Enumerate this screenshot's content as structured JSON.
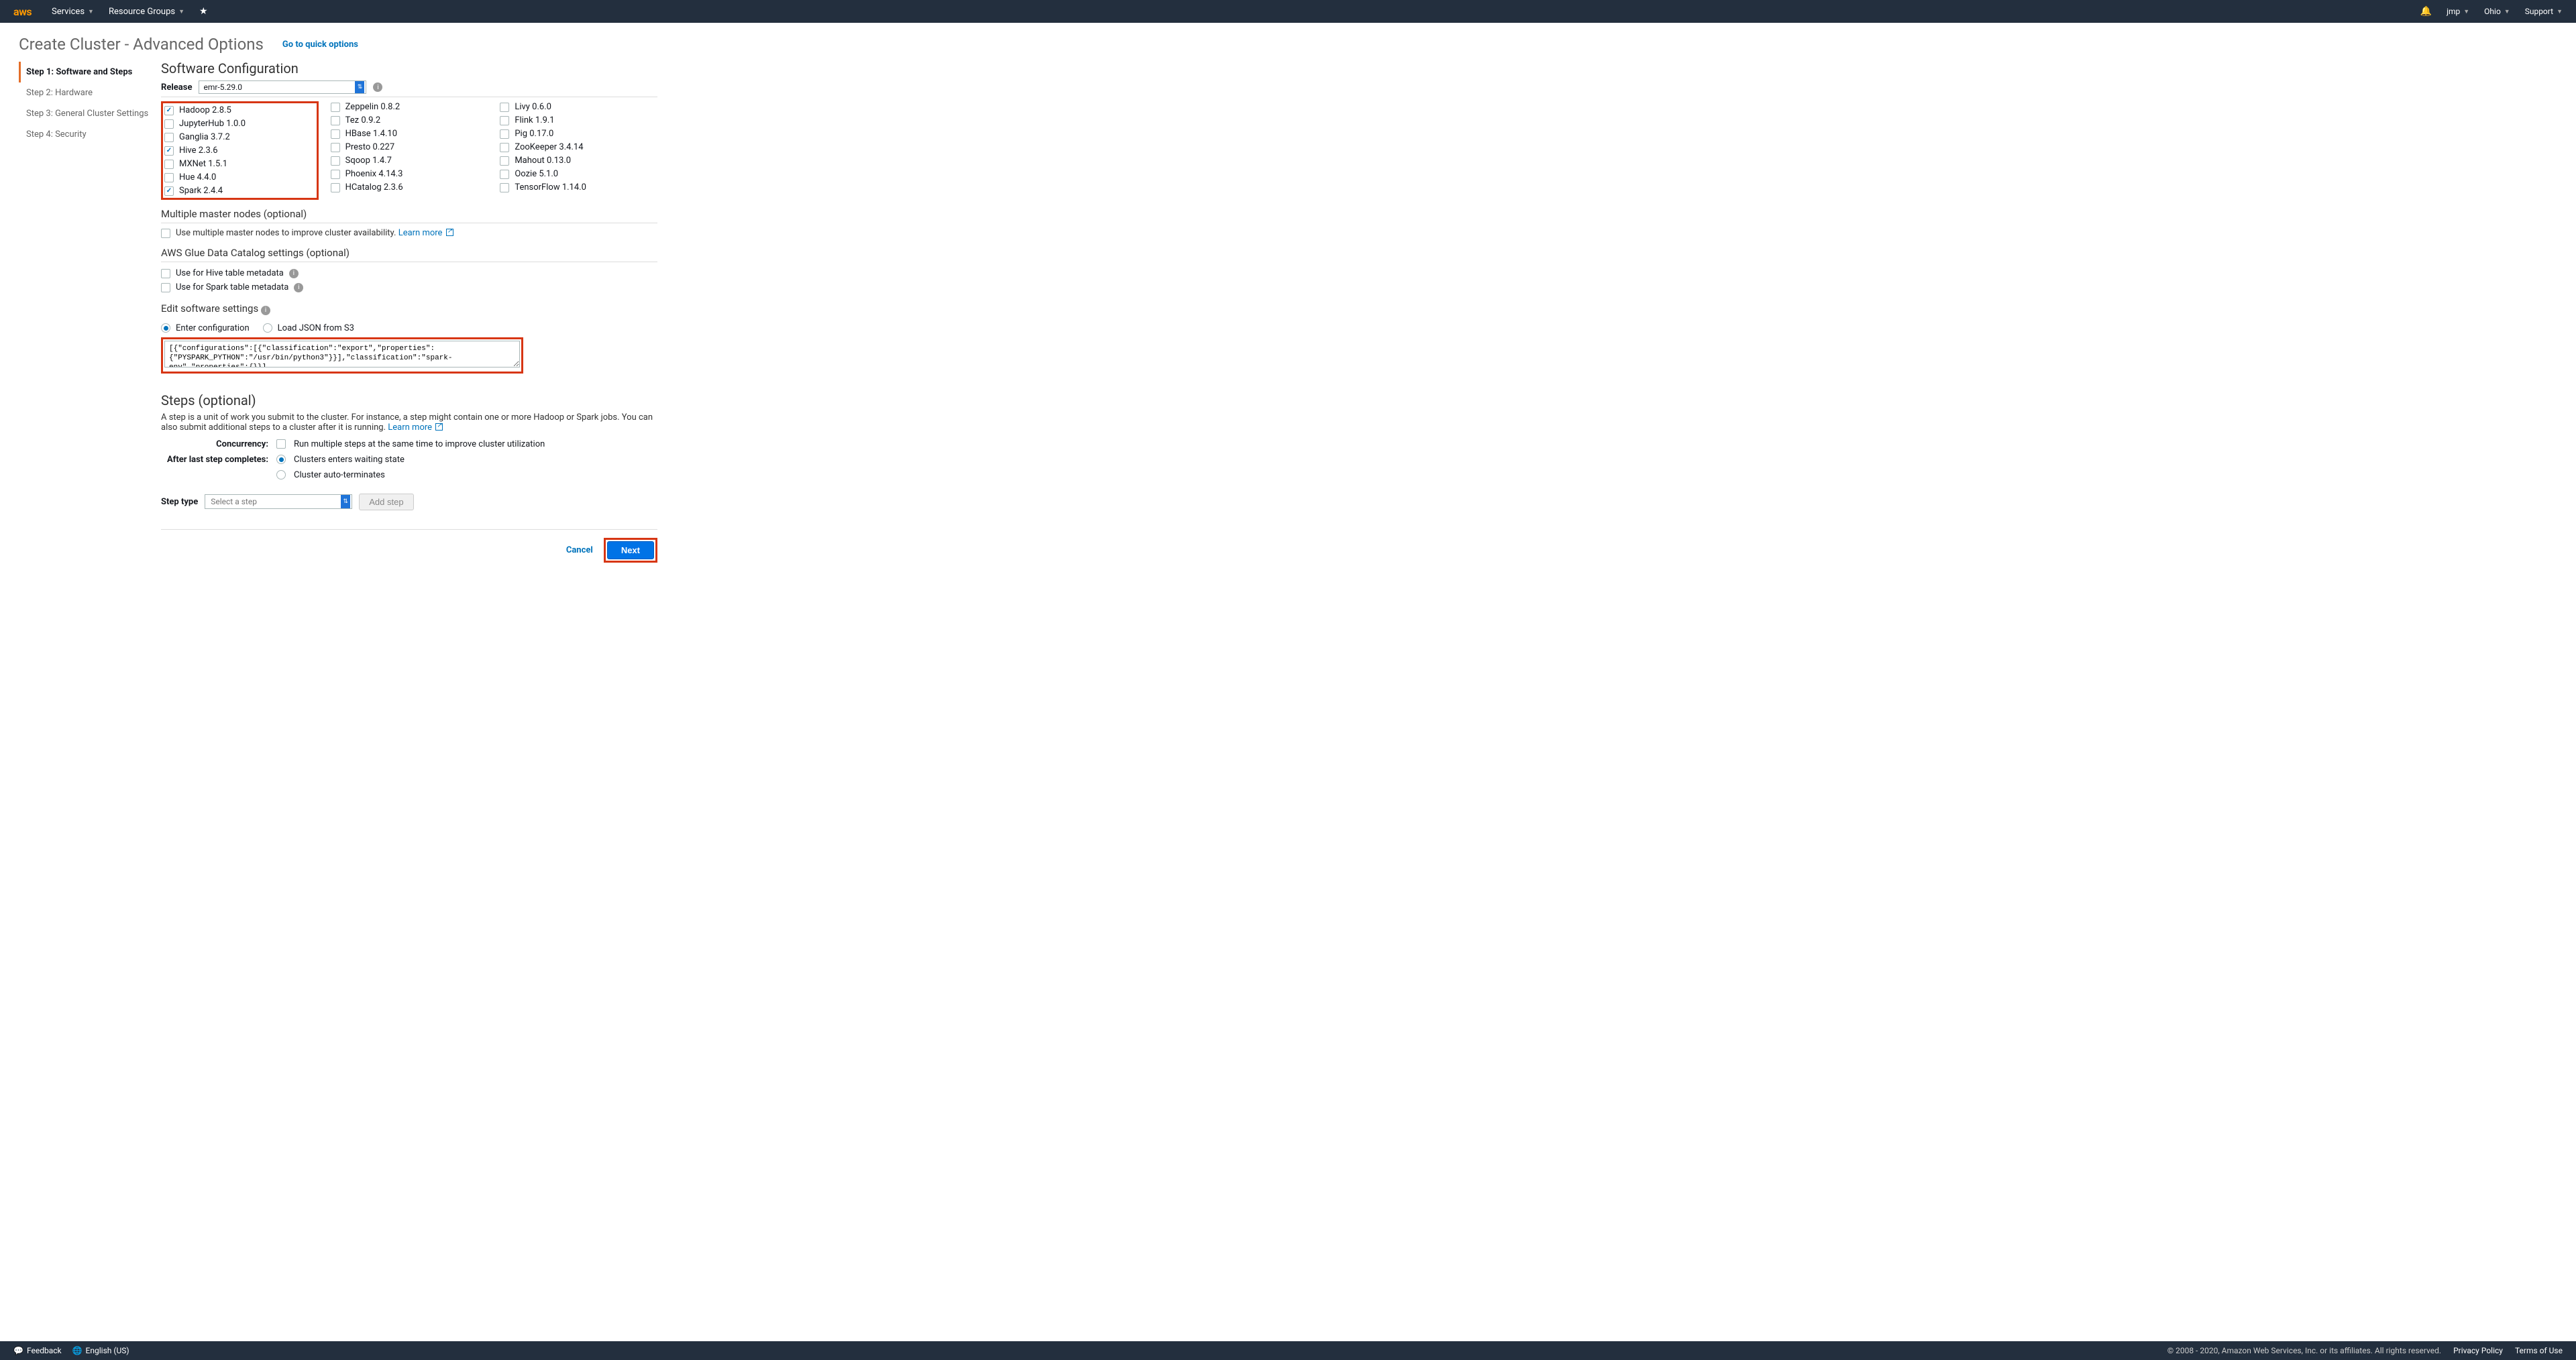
{
  "topbar": {
    "logo": "aws",
    "services": "Services",
    "resource_groups": "Resource Groups",
    "username": "jmp",
    "region": "Ohio",
    "support": "Support"
  },
  "page": {
    "title": "Create Cluster - Advanced Options",
    "quick_link": "Go to quick options"
  },
  "steps": [
    {
      "label": "Step 1: Software and Steps",
      "active": true
    },
    {
      "label": "Step 2: Hardware",
      "active": false
    },
    {
      "label": "Step 3: General Cluster Settings",
      "active": false
    },
    {
      "label": "Step 4: Security",
      "active": false
    }
  ],
  "software": {
    "section_title": "Software Configuration",
    "release_label": "Release",
    "release_value": "emr-5.29.0",
    "columns": [
      [
        {
          "label": "Hadoop 2.8.5",
          "checked": true
        },
        {
          "label": "JupyterHub 1.0.0",
          "checked": false
        },
        {
          "label": "Ganglia 3.7.2",
          "checked": false
        },
        {
          "label": "Hive 2.3.6",
          "checked": true
        },
        {
          "label": "MXNet 1.5.1",
          "checked": false
        },
        {
          "label": "Hue 4.4.0",
          "checked": false
        },
        {
          "label": "Spark 2.4.4",
          "checked": true
        }
      ],
      [
        {
          "label": "Zeppelin 0.8.2",
          "checked": false
        },
        {
          "label": "Tez 0.9.2",
          "checked": false
        },
        {
          "label": "HBase 1.4.10",
          "checked": false
        },
        {
          "label": "Presto 0.227",
          "checked": false
        },
        {
          "label": "Sqoop 1.4.7",
          "checked": false
        },
        {
          "label": "Phoenix 4.14.3",
          "checked": false
        },
        {
          "label": "HCatalog 2.3.6",
          "checked": false
        }
      ],
      [
        {
          "label": "Livy 0.6.0",
          "checked": false
        },
        {
          "label": "Flink 1.9.1",
          "checked": false
        },
        {
          "label": "Pig 0.17.0",
          "checked": false
        },
        {
          "label": "ZooKeeper 3.4.14",
          "checked": false
        },
        {
          "label": "Mahout 0.13.0",
          "checked": false
        },
        {
          "label": "Oozie 5.1.0",
          "checked": false
        },
        {
          "label": "TensorFlow 1.14.0",
          "checked": false
        }
      ]
    ]
  },
  "multiple_master": {
    "heading": "Multiple master nodes (optional)",
    "checkbox_label": "Use multiple master nodes to improve cluster availability.",
    "learn_more": "Learn more"
  },
  "glue": {
    "heading": "AWS Glue Data Catalog settings (optional)",
    "hive_label": "Use for Hive table metadata",
    "spark_label": "Use for Spark table metadata"
  },
  "edit_settings": {
    "heading": "Edit software settings",
    "enter_config": "Enter configuration",
    "load_json": "Load JSON from S3",
    "config_text": "[{\"configurations\":[{\"classification\":\"export\",\"properties\":{\"PYSPARK_PYTHON\":\"/usr/bin/python3\"}}],\"classification\":\"spark-env\",\"properties\":{}}]"
  },
  "steps_section": {
    "heading": "Steps (optional)",
    "description_prefix": "A step is a unit of work you submit to the cluster. For instance, a step might contain one or more Hadoop or Spark jobs. You can also submit additional steps to a cluster after it is running.",
    "learn_more": "Learn more",
    "concurrency_label": "Concurrency:",
    "concurrency_text": "Run multiple steps at the same time to improve cluster utilization",
    "after_last_label": "After last step completes:",
    "waiting_label": "Clusters enters waiting state",
    "terminate_label": "Cluster auto-terminates",
    "step_type_label": "Step type",
    "step_type_value": "Select a step",
    "add_step": "Add step"
  },
  "footer": {
    "cancel": "Cancel",
    "next": "Next"
  },
  "bottombar": {
    "feedback": "Feedback",
    "language": "English (US)",
    "copyright": "© 2008 - 2020, Amazon Web Services, Inc. or its affiliates. All rights reserved.",
    "privacy": "Privacy Policy",
    "terms": "Terms of Use"
  }
}
